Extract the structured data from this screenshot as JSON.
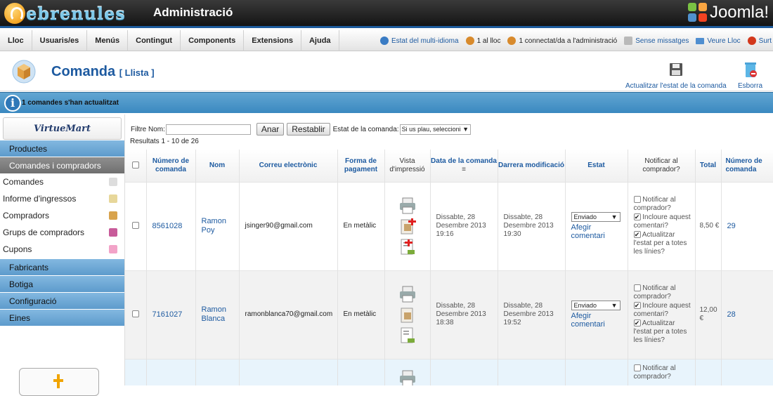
{
  "topbar": {
    "logo_text": "ebrenules",
    "title": "Administració",
    "brand": "Joomla!"
  },
  "menu": [
    "Lloc",
    "Usuaris/es",
    "Menús",
    "Contingut",
    "Components",
    "Extensions",
    "Ajuda"
  ],
  "status": {
    "multilang": "Estat del multi-idioma",
    "on_site": "1 al lloc",
    "admins": "1 connectat/da a l'administració",
    "messages": "Sense missatges",
    "view_site": "Veure Lloc",
    "logout": "Surt"
  },
  "header": {
    "title": "Comanda",
    "subtitle": "[ Llista ]"
  },
  "toolbar": {
    "update_status": "Actualitzar l'estat de la comanda",
    "delete": "Esborra"
  },
  "message": "1 comandes s'han actualitzat",
  "sidebar": {
    "logo": "VirtueMart",
    "sections": [
      {
        "label": "Productes",
        "active": false
      },
      {
        "label": "Comandes i compradors",
        "active": true
      }
    ],
    "items": [
      "Comandes",
      "Informe d'ingressos",
      "Compradors",
      "Grups de compradors",
      "Cupons"
    ],
    "bottom_sections": [
      "Fabricants",
      "Botiga",
      "Configuració",
      "Eines"
    ]
  },
  "filters": {
    "name_label": "Filtre Nom:",
    "name_value": "",
    "go_label": "Anar",
    "reset_label": "Restablir",
    "state_label": "Estat de la comanda:",
    "state_value": "Si us plau, seleccioni"
  },
  "results": "Resultats 1 - 10 de 26",
  "table": {
    "headers": [
      "Número de comanda",
      "Nom",
      "Correu electrònic",
      "Forma de pagament",
      "Vista d'impressió",
      "Data de la comanda",
      "Darrera modificació",
      "Estat",
      "Notificar al comprador?",
      "Total",
      "Número de comanda"
    ],
    "notify_labels": {
      "notify": "Notificar al comprador?",
      "include": "Incloure aquest comentari?",
      "update": "Actualitzar l'estat per a totes les línies?"
    },
    "add_comment": "Afegir comentari",
    "rows": [
      {
        "number": "8561028",
        "name": "Ramon Poy",
        "email": "jsinger90@gmail.com",
        "payment": "En metàlic",
        "date": "Dissabte, 28 Desembre 2013 19:16",
        "modified": "Dissabte, 28 Desembre 2013 19:30",
        "status": "Enviado",
        "total": "8,50 €",
        "id": "29"
      },
      {
        "number": "7161027",
        "name": "Ramon Blanca",
        "email": "ramonblanca70@gmail.com",
        "payment": "En metàlic",
        "date": "Dissabte, 28 Desembre 2013 18:38",
        "modified": "Dissabte, 28 Desembre 2013 19:52",
        "status": "Enviado",
        "total": "12,00 €",
        "id": "28"
      }
    ]
  },
  "colors": {
    "accent": "#1d5aa0",
    "message_bar": "#4a97c9",
    "sidebar_section": "#6ea9d6"
  }
}
